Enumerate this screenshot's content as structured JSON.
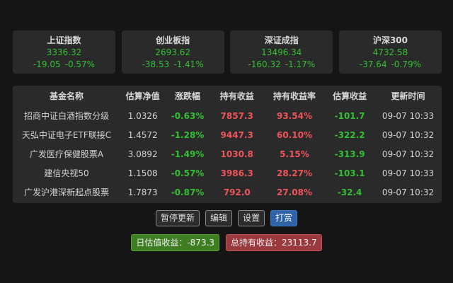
{
  "indices": [
    {
      "name": "上证指数",
      "value": "3336.32",
      "change": "-19.05",
      "pct": "-0.57%"
    },
    {
      "name": "创业板指",
      "value": "2693.62",
      "change": "-38.53",
      "pct": "-1.41%"
    },
    {
      "name": "深证成指",
      "value": "13496.34",
      "change": "-160.32",
      "pct": "-1.17%"
    },
    {
      "name": "沪深300",
      "value": "4732.58",
      "change": "-37.64",
      "pct": "-0.79%"
    }
  ],
  "table": {
    "headers": {
      "name": "基金名称",
      "nav": "估算净值",
      "pct": "涨跌幅",
      "hold": "持有收益",
      "holdpct": "持有收益率",
      "est": "估算收益",
      "time": "更新时间"
    },
    "rows": [
      {
        "name": "招商中证白酒指数分级",
        "nav": "1.0326",
        "pct": "-0.63%",
        "hold": "7857.3",
        "holdpct": "93.54%",
        "est": "-101.7",
        "time": "09-07 10:33"
      },
      {
        "name": "天弘中证电子ETF联接C",
        "nav": "1.4572",
        "pct": "-1.28%",
        "hold": "9447.3",
        "holdpct": "60.10%",
        "est": "-322.2",
        "time": "09-07 10:32"
      },
      {
        "name": "广发医疗保健股票A",
        "nav": "3.0892",
        "pct": "-1.49%",
        "hold": "1030.8",
        "holdpct": "5.15%",
        "est": "-313.9",
        "time": "09-07 10:32"
      },
      {
        "name": "建信央视50",
        "nav": "1.1508",
        "pct": "-0.57%",
        "hold": "3986.3",
        "holdpct": "28.27%",
        "est": "-103.1",
        "time": "09-07 10:33"
      },
      {
        "name": "广发沪港深新起点股票",
        "nav": "1.7873",
        "pct": "-0.87%",
        "hold": "792.0",
        "holdpct": "27.08%",
        "est": "-32.4",
        "time": "09-07 10:32"
      }
    ]
  },
  "buttons": {
    "pause": "暂停更新",
    "edit": "编辑",
    "settings": "设置",
    "tip": "打赏"
  },
  "summary": {
    "daily": "日估值收益：-873.3",
    "total": "总持有收益：23113.7"
  },
  "colors": {
    "up": "#f0555c",
    "down": "#33c033",
    "primary_button": "#2e63a6"
  }
}
